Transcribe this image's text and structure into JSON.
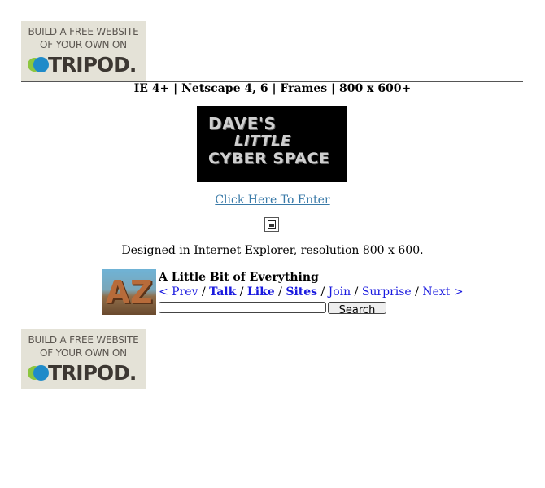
{
  "ad_top": {
    "line1": "BUILD A FREE WEBSITE",
    "line2": "OF YOUR OWN ON",
    "brand": "TRIPOD."
  },
  "compat_line": "IE 4+ | Netscape 4, 6 | Frames | 800 x 600+",
  "banner": {
    "line1": "DAVE'S",
    "line2": "LITTLE",
    "line3": "CYBER SPACE"
  },
  "enter_link": "Click Here To Enter",
  "designed_text": "Designed in Internet Explorer, resolution 800 x 600.",
  "webring": {
    "title": "A Little Bit of Everything",
    "logo_text_a": "A",
    "logo_text_z": "Z",
    "nav": {
      "prev": "< Prev",
      "talk": "Talk",
      "like": "Like",
      "sites": "Sites",
      "join": "Join",
      "surprise": "Surprise",
      "next": "Next >",
      "sep": " / "
    },
    "search_button": "Search"
  },
  "ad_bottom": {
    "line1": "BUILD A FREE WEBSITE",
    "line2": "OF YOUR OWN ON",
    "brand": "TRIPOD."
  }
}
